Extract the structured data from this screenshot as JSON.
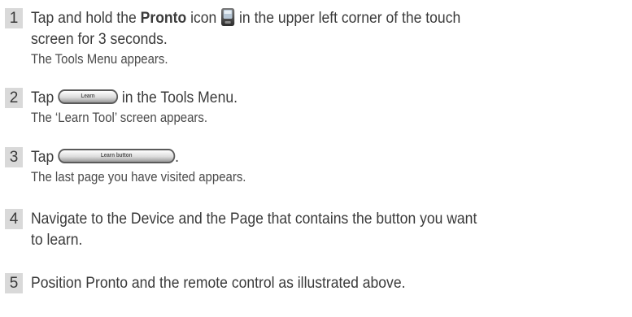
{
  "steps": [
    {
      "number": "1",
      "text_before": "Tap and hold the ",
      "bold": "Pronto",
      "text_mid": " icon ",
      "icon": "pronto-icon",
      "text_after": " in the upper left corner of the touch",
      "text_line2": "screen for 3 seconds.",
      "result": "The Tools Menu appears."
    },
    {
      "number": "2",
      "text_before": "Tap ",
      "button_label": "Learn",
      "text_after": " in the Tools Menu.",
      "result": "The ‘Learn Tool’ screen appears."
    },
    {
      "number": "3",
      "text_before": "Tap ",
      "button_label": "Learn button",
      "text_after": ".",
      "result": "The last page you have visited appears."
    },
    {
      "number": "4",
      "text": "Navigate to the Device and the Page that contains the button you want",
      "text_line2": "to learn."
    },
    {
      "number": "5",
      "text": "Position Pronto and the remote control as illustrated above."
    }
  ]
}
